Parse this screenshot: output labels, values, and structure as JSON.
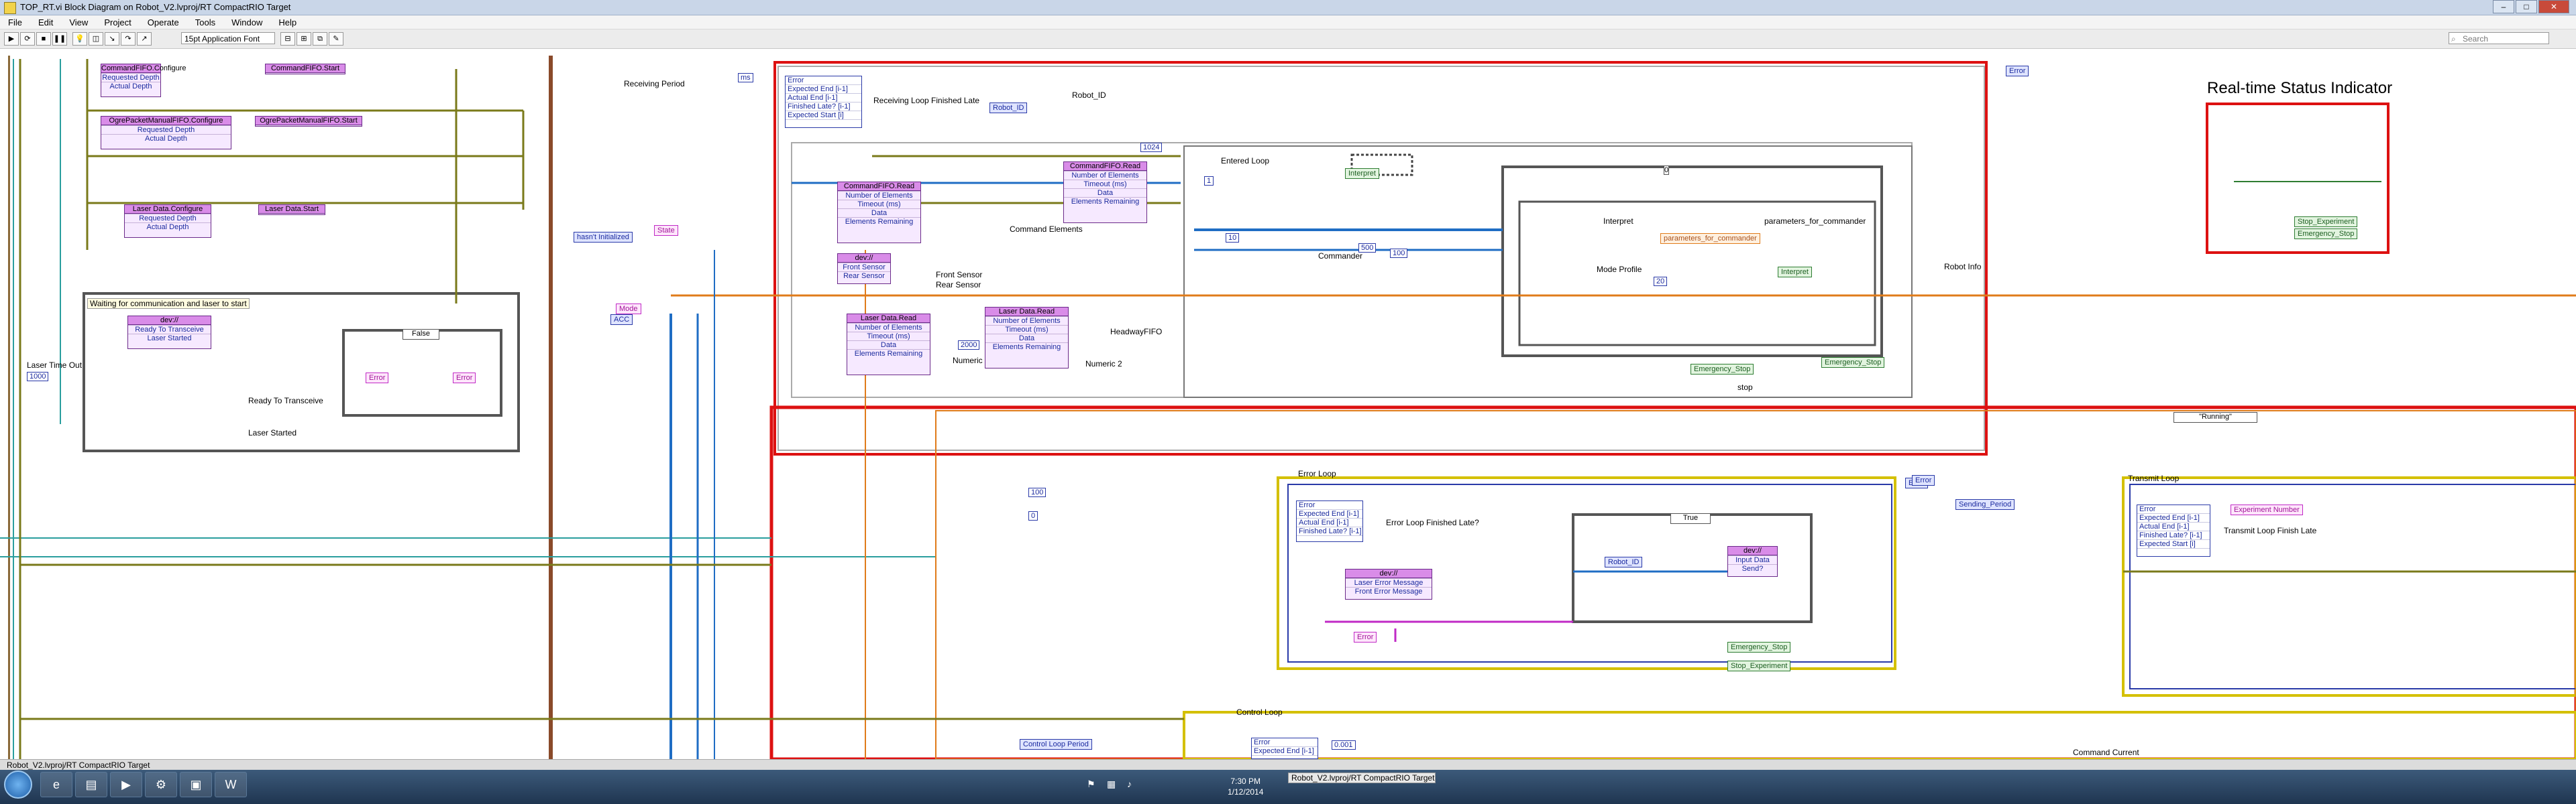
{
  "window": {
    "title": "TOP_RT.vi Block Diagram on Robot_V2.lvproj/RT CompactRIO Target",
    "controls": [
      "–",
      "□",
      "✕"
    ]
  },
  "menu": [
    "File",
    "Edit",
    "View",
    "Project",
    "Operate",
    "Tools",
    "Window",
    "Help"
  ],
  "toolbar": {
    "font_select": "15pt Application Font",
    "search_placeholder": "Search"
  },
  "diagram": {
    "labels": {
      "receiving_period": "Receiving Period",
      "receiving_late": "Receiving Loop Finished Late",
      "robot_id_label": "Robot_ID",
      "entered_loop": "Entered Loop",
      "command_elements": "Command Elements",
      "commander": "Commander",
      "interpret": "Interpret",
      "parameters_for_commander": "parameters_for_commander",
      "mode_profile": "Mode Profile",
      "front_sensor": "Front Sensor",
      "rear_sensor": "Rear Sensor",
      "numeric": "Numeric",
      "numeric2": "Numeric 2",
      "headway_fifo": "HeadwayFIFO",
      "robot_info": "Robot Info",
      "stop": "stop",
      "realtime_status": "Real-time Status Indicator",
      "waiting": "Waiting for communication and laser to start",
      "laser_time_out": "Laser Time Out",
      "ready_to_transceive": "Ready To Transceive",
      "laser_started": "Laser Started",
      "error_loop": "Error Loop",
      "error_loop_late": "Error Loop Finished Late?",
      "sending_period": "Sending_Period",
      "transmit_loop": "Transmit Loop",
      "transmit_loop_late": "Transmit Loop Finish Late",
      "control_loop": "Control Loop",
      "command_current": "Command Current"
    },
    "nodes": {
      "cmdfifo_configure": [
        "CommandFIFO.Configure",
        "Requested Depth",
        "Actual Depth"
      ],
      "cmdfifo_start": "CommandFIFO.Start",
      "ogre_configure": [
        "OgrePacketManualFIFO.Configure",
        "Requested Depth",
        "Actual Depth"
      ],
      "ogre_start": "OgrePacketManualFIFO.Start",
      "laser_configure": [
        "Laser Data.Configure",
        "Requested Depth",
        "Actual Depth"
      ],
      "laser_start": "Laser Data.Start",
      "dev_ready": [
        "dev://",
        "Ready To Transceive",
        "Laser Started"
      ],
      "cmdfifo_read1": [
        "CommandFIFO.Read",
        "Number of Elements",
        "Timeout (ms)",
        "Data",
        "Elements Remaining"
      ],
      "cmdfifo_read2": [
        "CommandFIFO.Read",
        "Number of Elements",
        "Timeout (ms)",
        "Data",
        "Elements Remaining"
      ],
      "dev_sensors": [
        "dev://",
        "Front Sensor",
        "Rear Sensor"
      ],
      "laser_read1": [
        "Laser Data.Read",
        "Number of Elements",
        "Timeout (ms)",
        "Data",
        "Elements Remaining"
      ],
      "laser_read2": [
        "Laser Data.Read",
        "Number of Elements",
        "Timeout (ms)",
        "Data",
        "Elements Remaining"
      ],
      "dev_error": [
        "dev://",
        "Laser Error Message",
        "Front Error Message"
      ],
      "dev_send": [
        "dev://",
        "Input Data",
        "Send?"
      ]
    },
    "error_clusters": {
      "receiving": [
        "Error",
        "Expected End [i-1]",
        "Actual End [i-1]",
        "Finished Late? [i-1]",
        "Expected Start [i]"
      ],
      "error_loop": [
        "Error",
        "Expected End [i-1]",
        "Actual End [i-1]",
        "Finished Late? [i-1]"
      ],
      "transmit": [
        "Error",
        "Expected End [i-1]",
        "Actual End [i-1]",
        "Finished Late? [i-1]",
        "Expected Start [i]"
      ],
      "control": [
        "Error",
        "Expected End [i-1]"
      ]
    },
    "controls": {
      "robot_id": "Robot_ID",
      "hasnt_initialized": "hasn't Initialized",
      "state": "State",
      "mode": "Mode",
      "acc": "ACC",
      "emergency_stop": "Emergency_Stop",
      "emergency_stop2": "Emergency_Stop",
      "stop_experiment": "Stop_Experiment",
      "emergency_stop3": "Emergency_Stop",
      "experiment_number": "Experiment Number",
      "control_loop_period": "Control Loop Period",
      "error_out": "Error",
      "error_out2": "Error",
      "error_out3": "Error",
      "robot_id2": "Robot_ID",
      "error_pink": "Error",
      "error_pink2": "Error",
      "error_pink3": "Error",
      "interpret_const": "Interpret",
      "interpret_const2": "Interpret",
      "params_commander": "parameters_for_commander"
    },
    "case_selectors": {
      "false_case": "False",
      "true_case": "True",
      "running_case": "\"Running\"",
      "zero_case": "0"
    },
    "constants": {
      "period_1000": "1000",
      "c1": "1",
      "c0": "0",
      "c500": "500",
      "c2000": "2000",
      "c100": "100",
      "c20": "20",
      "c0001": "0.001",
      "c_ms": "ms",
      "c1024": "1024",
      "c10": "10"
    }
  },
  "statusbar": {
    "path": "Robot_V2.lvproj/RT CompactRIO Target"
  },
  "taskbar": {
    "active_window": "Robot_V2.lvproj/RT CompactRIO Target",
    "time": "7:30 PM",
    "date": "1/12/2014"
  }
}
